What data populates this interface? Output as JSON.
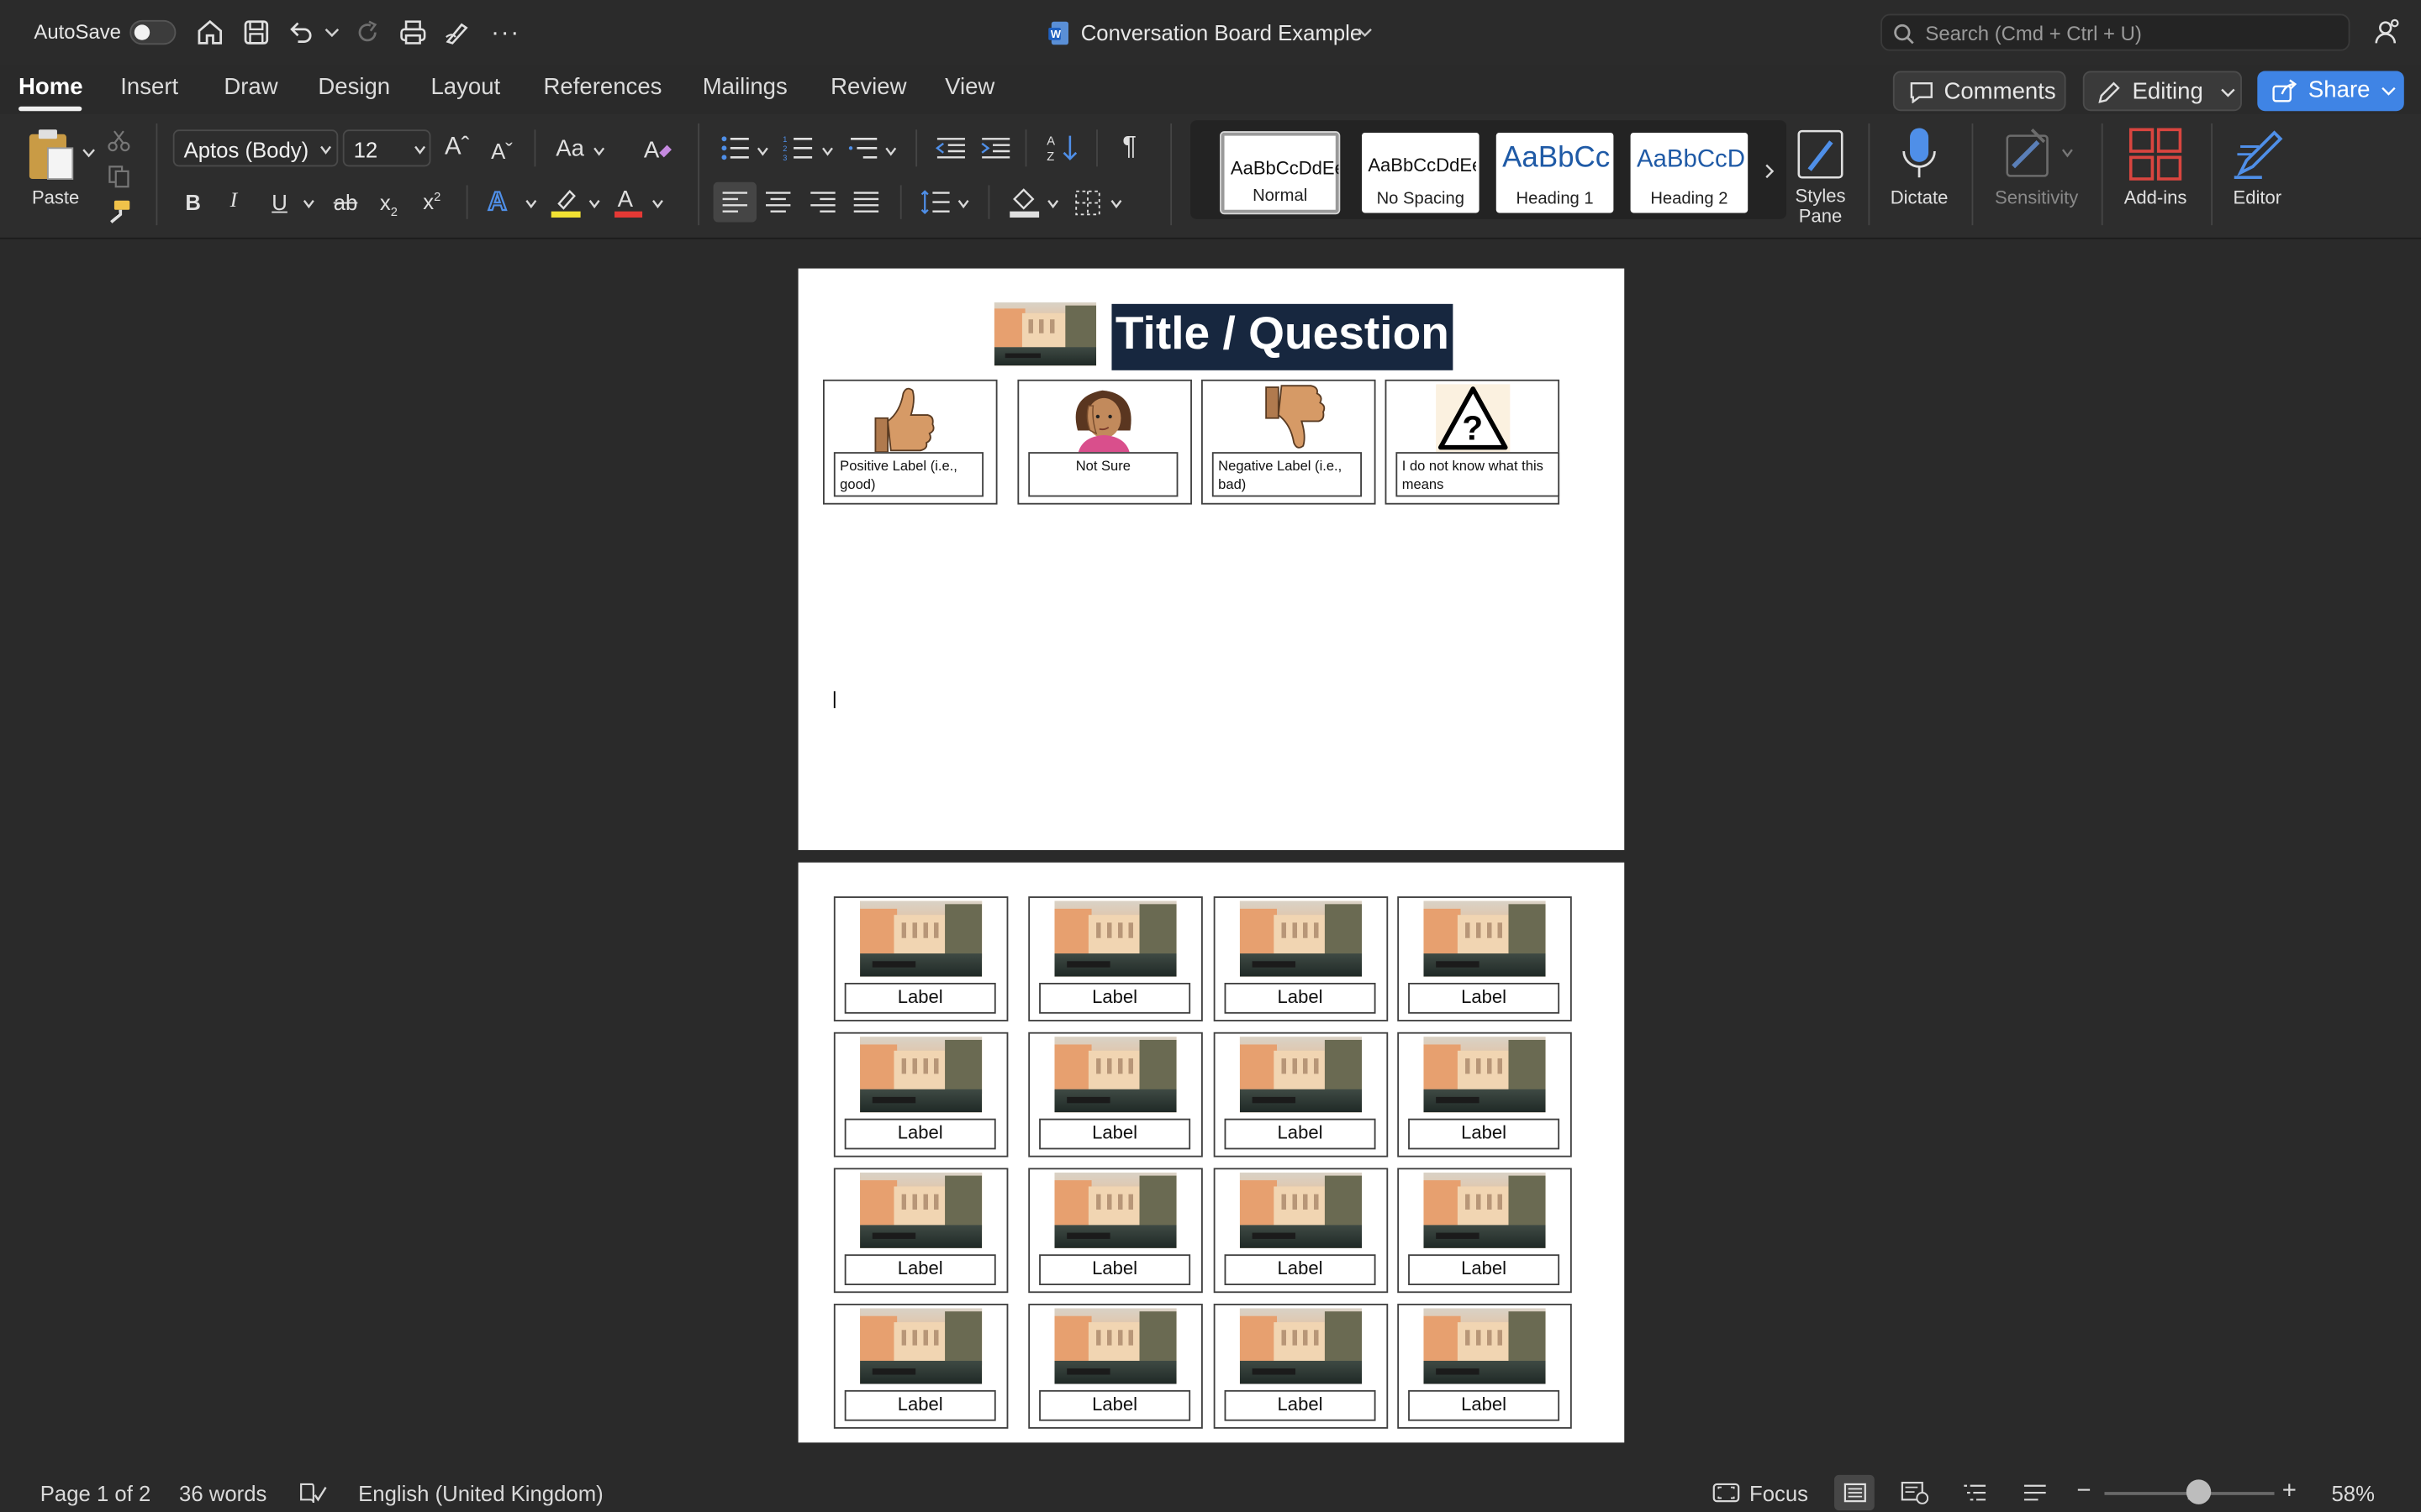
{
  "titlebar": {
    "autosave_label": "AutoSave",
    "doc_title": "Conversation Board Example",
    "search_placeholder": "Search (Cmd + Ctrl + U)"
  },
  "tabs": [
    "Home",
    "Insert",
    "Draw",
    "Design",
    "Layout",
    "References",
    "Mailings",
    "Review",
    "View"
  ],
  "active_tab": "Home",
  "header_buttons": {
    "comments": "Comments",
    "editing": "Editing",
    "share": "Share"
  },
  "ribbon": {
    "paste_label": "Paste",
    "font_name": "Aptos (Body)",
    "font_size": "12",
    "case_label": "Aa",
    "styles": [
      {
        "sample": "AaBbCcDdEe",
        "name": "Normal"
      },
      {
        "sample": "AaBbCcDdEe",
        "name": "No Spacing"
      },
      {
        "sample": "AaBbCc",
        "name": "Heading 1"
      },
      {
        "sample": "AaBbCcDd",
        "name": "Heading 2"
      }
    ],
    "styles_pane_label": "Styles Pane",
    "dictate_label": "Dictate",
    "sensitivity_label": "Sensitivity",
    "addins_label": "Add-ins",
    "editor_label": "Editor"
  },
  "document": {
    "title": "Title / Question",
    "response_cards": [
      {
        "label": "Positive Label (i.e., good)",
        "icon": "thumbs-up-icon"
      },
      {
        "label": "Not Sure",
        "icon": "thinking-person-icon"
      },
      {
        "label": "Negative Label (i.e., bad)",
        "icon": "thumbs-down-icon"
      },
      {
        "label": "I do not know what this means",
        "icon": "warning-question-icon"
      }
    ],
    "grid_labels": [
      "Label",
      "Label",
      "Label",
      "Label",
      "Label",
      "Label",
      "Label",
      "Label",
      "Label",
      "Label",
      "Label",
      "Label",
      "Label",
      "Label",
      "Label",
      "Label"
    ]
  },
  "statusbar": {
    "page_info": "Page 1 of 2",
    "word_count": "36 words",
    "language": "English (United Kingdom)",
    "focus_label": "Focus",
    "zoom": "58%",
    "zoom_fraction": 0.55
  },
  "colors": {
    "accent_blue": "#3f84e5",
    "title_box": "#17273f",
    "dark_bg": "#2a2a2a",
    "addins_red": "#d9453f",
    "highlight_yellow": "#f2e233",
    "font_color_red": "#e53935"
  }
}
